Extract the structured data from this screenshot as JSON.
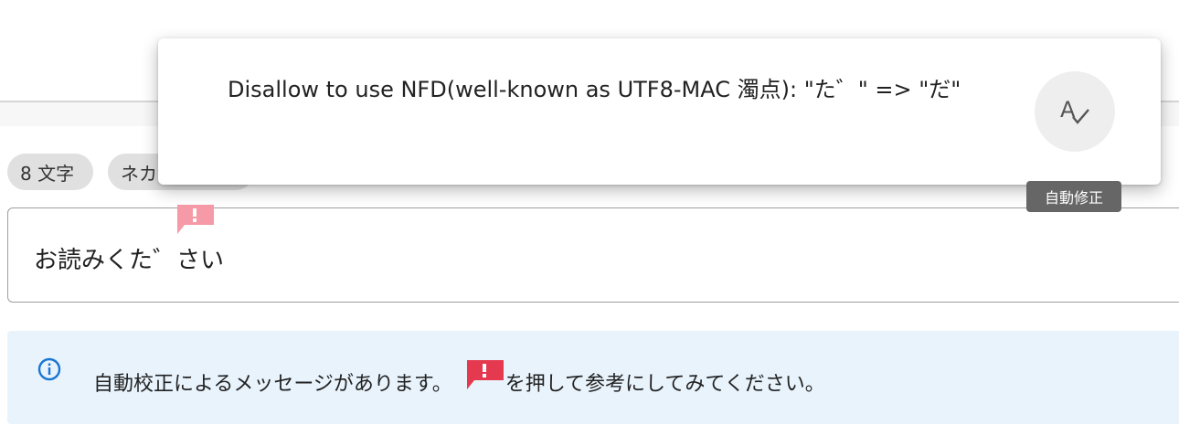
{
  "chips": {
    "count_label": "8 文字",
    "type_label": "ネカ"
  },
  "field": {
    "value": "お読みくた゛さい",
    "flag_icon": "exclamation-flag-icon"
  },
  "popover": {
    "message": "Disallow to use NFD(well-known as UTF8-MAC 濁点): \"た゛\" => \"だ\"",
    "fix_icon": "spellcheck-icon",
    "tooltip": "自動修正"
  },
  "info": {
    "icon": "info-circle-icon",
    "text_before": "自動校正によるメッセージがあります。",
    "text_after": "を押して参考にしてみてください。"
  },
  "colors": {
    "flag": "#e53950",
    "info_bg": "#e8f3fc",
    "info_icon": "#1976d2",
    "tooltip_bg": "#666666",
    "chip_bg": "#e0e0e0",
    "warn_dot": "#f4a321"
  }
}
